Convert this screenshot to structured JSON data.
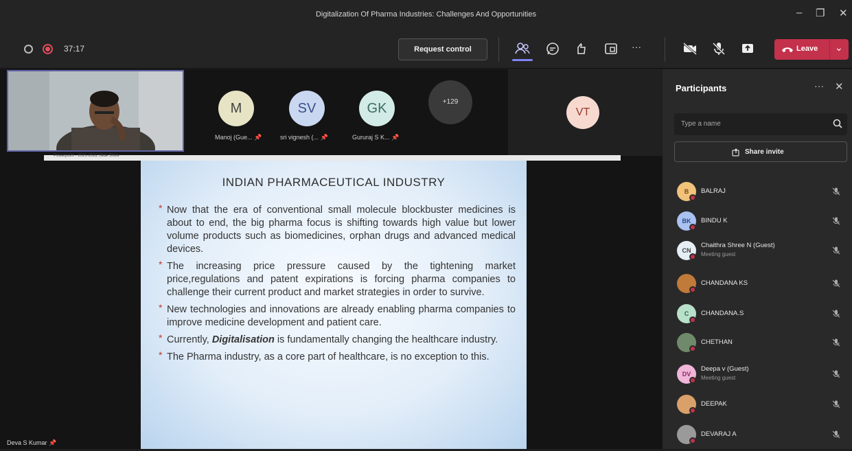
{
  "window": {
    "title": "Digitalization Of Pharma Industries: Challenges And Opportunities",
    "minimize": "–",
    "maximize": "❐",
    "close": "✕"
  },
  "toolbar": {
    "timer": "37:17",
    "request_control": "Request control",
    "leave": "Leave",
    "more": "···",
    "leave_chevron": "⌄",
    "colors": {
      "accent": "#7f85f5",
      "leave": "#c4314b",
      "recording": "#e44c5b"
    }
  },
  "gallery": {
    "avatars": [
      {
        "initials": "M",
        "name": "Manoj (Gue...",
        "bg": "#e7e4c6",
        "fg": "#444"
      },
      {
        "initials": "SV",
        "name": "sri vignesh (...",
        "bg": "#c9d8f0",
        "fg": "#3a4f8a"
      },
      {
        "initials": "GK",
        "name": "Gururaj S K...",
        "bg": "#d3ebe6",
        "fg": "#3b6b62"
      }
    ],
    "overflow": "+129",
    "standalone": {
      "initials": "VT",
      "bg": "#f7d9d0",
      "fg": "#9a3a2a"
    }
  },
  "slide": {
    "window_caption": "Powerpoint - 2021-2022 Slide Show",
    "title": "INDIAN PHARMACEUTICAL INDUSTRY",
    "bullet_mark": "*",
    "bullets": [
      "Now that the era of conventional small molecule blockbuster medicines is about to end, the big pharma focus is shifting towards high value but lower volume products such as biomedicines, orphan drugs and advanced medical devices.",
      "The increasing price pressure caused by the tightening market price,regulations and patent expirations is forcing pharma companies to challenge their current product and market strategies in order to survive.",
      "New technologies and innovations are already enabling pharma companies to improve medicine development and patient care.",
      {
        "pre": "Currently, ",
        "em": "Digitalisation",
        "post": " is fundamentally changing the healthcare industry."
      },
      "The Pharma industry, as a core part of healthcare, is no exception to this."
    ]
  },
  "presenter": {
    "name": "Deva S Kumar"
  },
  "participants": {
    "title": "Participants",
    "more": "···",
    "close": "✕",
    "search_placeholder": "Type a name",
    "share_invite": "Share invite",
    "list": [
      {
        "name": "BALRAJ",
        "initials": "B",
        "bg": "#f0c27a",
        "fg": "#7a4a10"
      },
      {
        "name": "BINDU K",
        "initials": "BK",
        "bg": "#a9c2f0",
        "fg": "#2b4a8a"
      },
      {
        "name": "Chaithra Shree N (Guest)",
        "sub": "Meeting guest",
        "initials": "CN",
        "bg": "#e5eef5",
        "fg": "#444"
      },
      {
        "name": "CHANDANA KS",
        "initials": "",
        "bg": "#c07a3a",
        "fg": "#fff"
      },
      {
        "name": "CHANDANA.S",
        "initials": "C",
        "bg": "#b9e0c9",
        "fg": "#2b6a48"
      },
      {
        "name": "CHETHAN",
        "initials": "",
        "bg": "#6f8a6a",
        "fg": "#fff"
      },
      {
        "name": "Deepa v (Guest)",
        "sub": "Meeting guest",
        "initials": "DV",
        "bg": "#f0b5d8",
        "fg": "#8a2c66"
      },
      {
        "name": "DEEPAK",
        "initials": "",
        "bg": "#d9a06a",
        "fg": "#fff"
      },
      {
        "name": "DEVARAJ A",
        "initials": "",
        "bg": "#9a9a9a",
        "fg": "#fff"
      }
    ]
  }
}
